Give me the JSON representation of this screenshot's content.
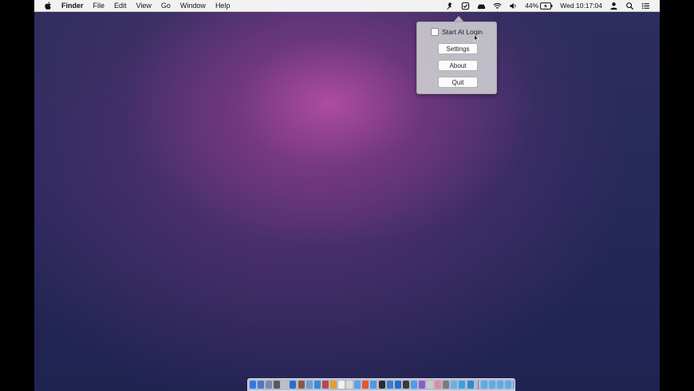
{
  "menubar": {
    "app_name": "Finder",
    "menus": [
      "File",
      "Edit",
      "View",
      "Go",
      "Window",
      "Help"
    ],
    "status": {
      "icons": [
        "pin-app-icon",
        "checkbox-status-icon",
        "drive-icon",
        "wifi-icon",
        "volume-icon"
      ],
      "battery_percent": "44%",
      "clock": "Wed 10:17:04",
      "right_icons": [
        "user-icon",
        "spotlight-icon",
        "notification-center-icon"
      ]
    }
  },
  "popup": {
    "start_at_login_label": "Start At Login",
    "start_at_login_checked": false,
    "settings_label": "Settings",
    "about_label": "About",
    "quit_label": "Quit"
  },
  "dock": {
    "app_colors": [
      "#2f7be0",
      "#4a78c8",
      "#7a8aa6",
      "#5a5a5a",
      "#c0c0c0",
      "#2a6fc9",
      "#8e5a3a",
      "#6a9fd8",
      "#3b88d8",
      "#b54a4a",
      "#e0a030",
      "#f0f0f0",
      "#d9d9d9",
      "#5fa0e0",
      "#e05a2a",
      "#4a9be8",
      "#2c2c2c",
      "#3a7fd0",
      "#1f6fc8",
      "#3a3a3a",
      "#4aa0e0",
      "#8a5ad0",
      "#c8c8c8",
      "#e08aa0",
      "#7a7a7a",
      "#6ab0e8",
      "#3aa0e0",
      "#2a8ad0"
    ],
    "folder_colors": [
      "#5aaee8",
      "#5aaee8",
      "#5aaee8",
      "#5aaee8",
      "#5aaee8",
      "#5aaee8",
      "#444444",
      "#9a9a9a"
    ]
  }
}
